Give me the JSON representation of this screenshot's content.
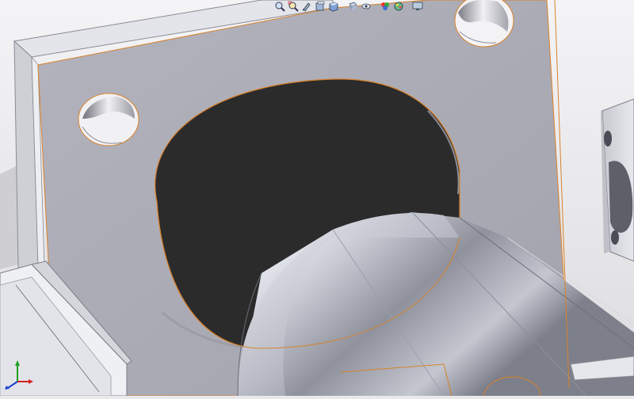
{
  "app": {
    "name": "3D CAD viewport"
  },
  "toolbar": {
    "items": [
      {
        "icon": "zoom-to-fit-icon"
      },
      {
        "icon": "zoom-to-area-icon"
      },
      {
        "icon": "previous-view-icon"
      },
      {
        "icon": "section-view-icon"
      },
      {
        "icon": "view-orientation-icon"
      },
      {
        "icon": "display-style-icon"
      },
      {
        "icon": "hide-show-items-icon"
      },
      {
        "icon": "edit-appearance-icon"
      },
      {
        "icon": "apply-scene-icon"
      },
      {
        "icon": "view-settings-icon"
      }
    ]
  },
  "colors": {
    "background": "#e9e9eb",
    "plate_face": "#a9a9b3",
    "plate_edge": "#d6d7dc",
    "hole_interior": "#2a2a2a",
    "shaft_light": "#eceef4",
    "shaft_dark": "#5a5c66",
    "highlight_edge": "#d9822b",
    "triad_x": "#d62020",
    "triad_y": "#20a020",
    "triad_z": "#2040d0"
  }
}
